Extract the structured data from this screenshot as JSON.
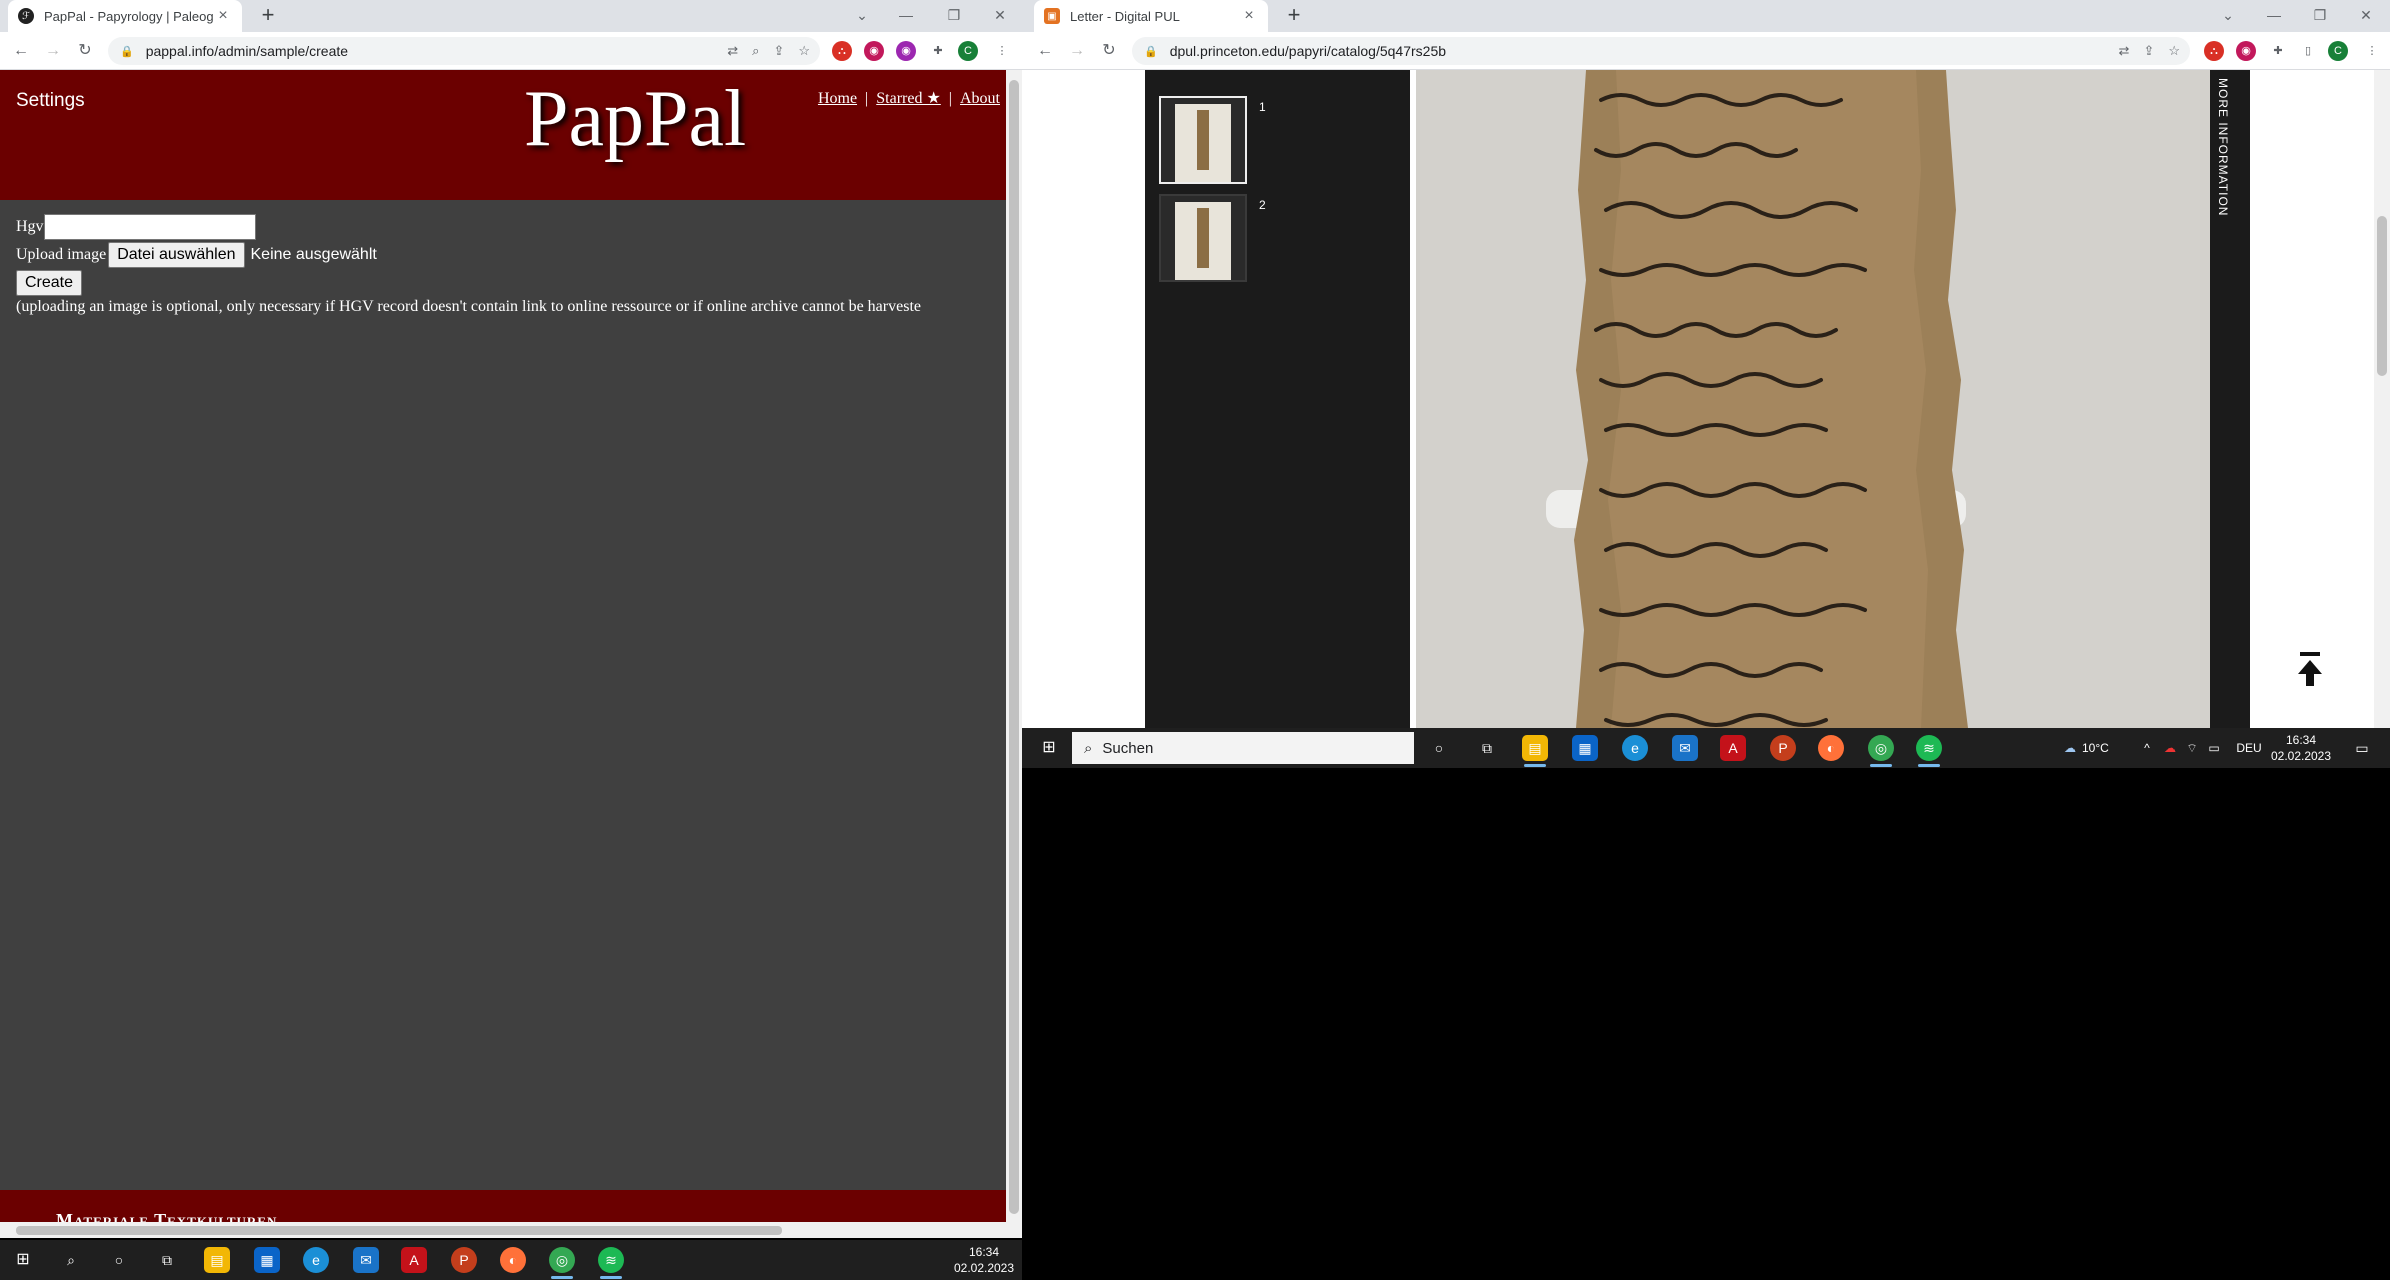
{
  "left_window": {
    "tab_title": "PapPal - Papyrology | Paleography",
    "url": "pappal.info/admin/sample/create",
    "favicon": "pappal-favicon",
    "profile_letter": "C"
  },
  "right_window": {
    "tab_title": "Letter - Digital PUL",
    "url": "dpul.princeton.edu/papyri/catalog/5q47rs25b",
    "profile_letter": "C"
  },
  "pappal": {
    "settings": "Settings",
    "logo": "PapPal",
    "nav": {
      "home": "Home",
      "separator": "|",
      "starred": "Starred ★",
      "about": "About"
    },
    "form": {
      "hgv_label": "Hgv",
      "hgv_value": "",
      "upload_label": "Upload image",
      "file_button": "Datei auswählen",
      "file_status": "Keine ausgewählt",
      "create_button": "Create",
      "note": "(uploading an image is optional, only necessary if HGV record doesn't contain link to online ressource or if online archive cannot be harveste"
    },
    "footer_text": "Materiale Textkulturen"
  },
  "dpul": {
    "thumbs": [
      {
        "num": "1"
      },
      {
        "num": "2"
      }
    ],
    "side_label": "MORE INFORMATION"
  },
  "taskbar_small": {
    "search_placeholder": "Suchen",
    "weather": "10°C",
    "lang": "DEU",
    "time": "16:34",
    "date": "02.02.2023"
  },
  "taskbar_bottom": {
    "time": "16:34",
    "date": "02.02.2023"
  }
}
